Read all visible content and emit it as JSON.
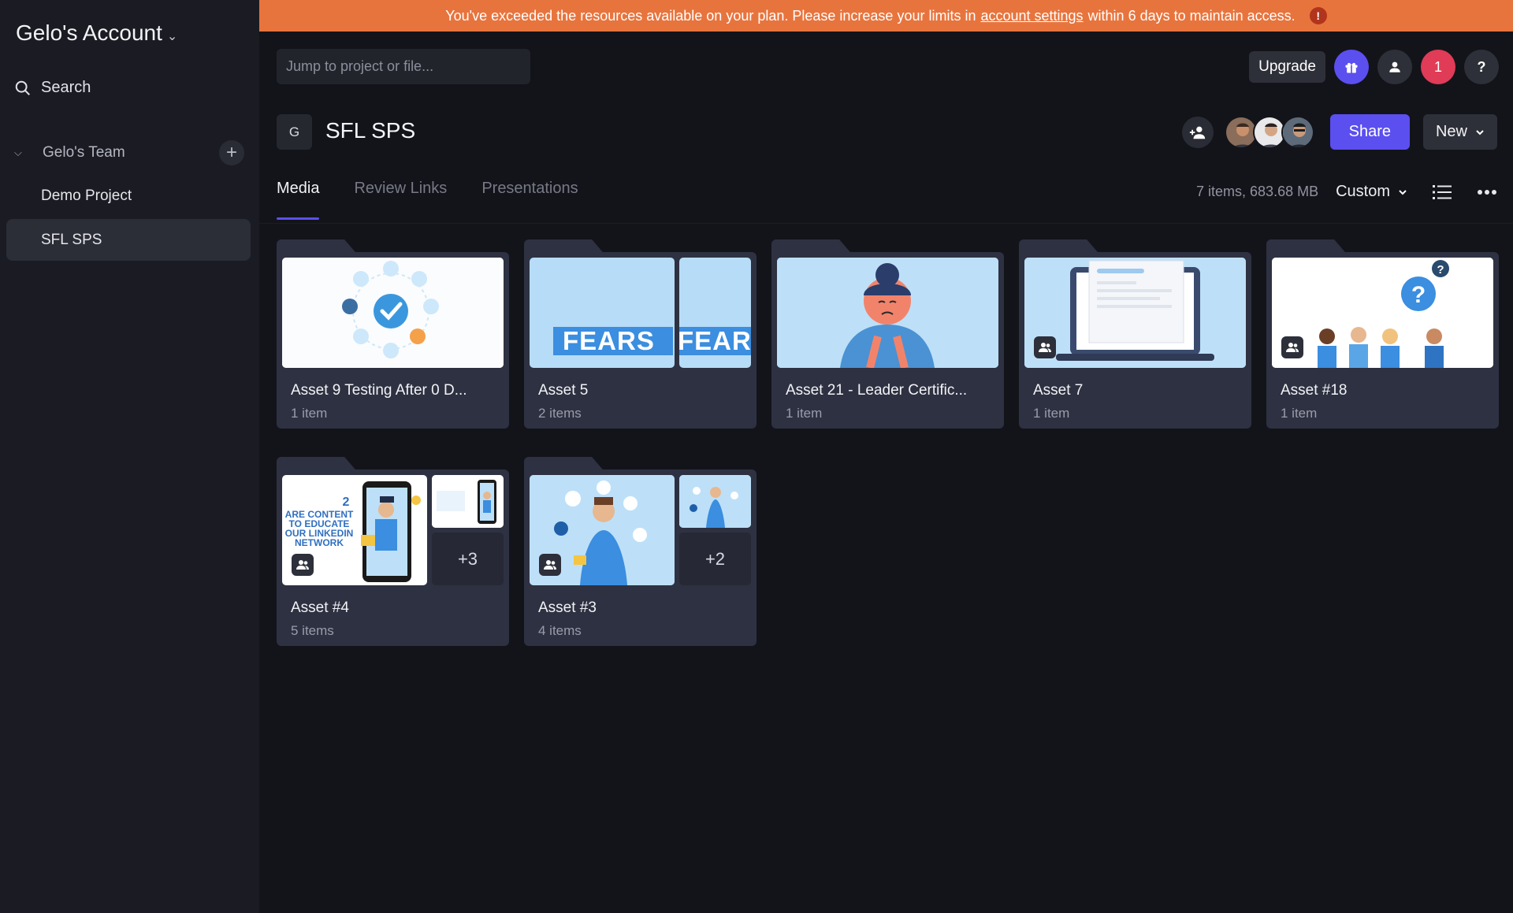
{
  "sidebar": {
    "account": "Gelo's Account",
    "search_label": "Search",
    "team": "Gelo's Team",
    "projects": [
      {
        "label": "Demo Project",
        "active": false
      },
      {
        "label": "SFL SPS",
        "active": true
      }
    ]
  },
  "banner": {
    "text_before": "You've exceeded the resources available on your plan. Please increase your limits in",
    "link": "account settings",
    "text_after": "within 6 days to maintain access."
  },
  "topbar": {
    "jump_placeholder": "Jump to project or file...",
    "upgrade_label": "Upgrade",
    "notification_count": "1",
    "help_label": "?"
  },
  "project": {
    "badge": "G",
    "title": "SFL SPS",
    "share_label": "Share",
    "new_label": "New"
  },
  "tabs": [
    {
      "label": "Media",
      "active": true
    },
    {
      "label": "Review Links",
      "active": false
    },
    {
      "label": "Presentations",
      "active": false
    }
  ],
  "meta": {
    "count": "7 items, 683.68 MB",
    "sort": "Custom"
  },
  "folders": [
    {
      "name": "Asset 9 Testing After 0 D...",
      "sub": "1 item"
    },
    {
      "name": "Asset 5",
      "sub": "2 items",
      "thumb_text": "FEARS"
    },
    {
      "name": "Asset 21 - Leader Certific...",
      "sub": "1 item"
    },
    {
      "name": "Asset 7",
      "sub": "1 item"
    },
    {
      "name": "Asset #18",
      "sub": "1 item"
    },
    {
      "name": "Asset #4",
      "sub": "5 items",
      "more": "+3",
      "thumb_text_lines": [
        "2",
        "ARE CONTENT",
        "TO EDUCATE",
        "OUR LINKEDIN",
        "NETWORK"
      ]
    },
    {
      "name": "Asset #3",
      "sub": "4 items",
      "more": "+2"
    }
  ],
  "colors": {
    "accent": "#5b4ff0",
    "banner": "#e8743d",
    "notification": "#e03b57",
    "card": "#2e3141"
  }
}
